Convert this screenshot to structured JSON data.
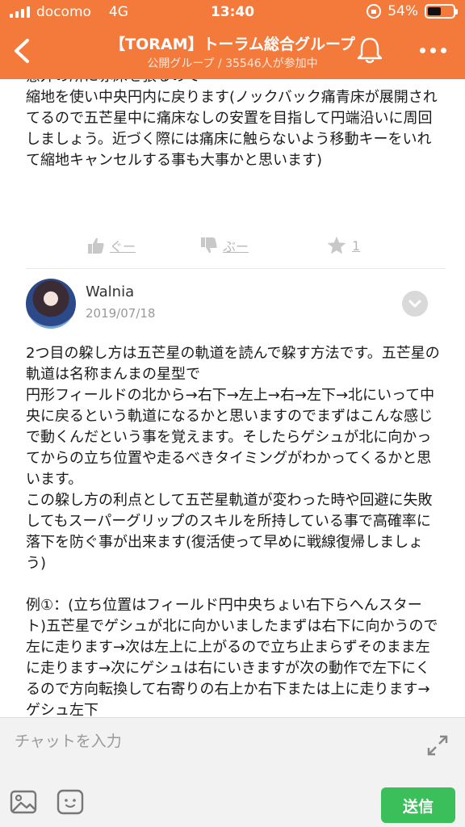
{
  "status_bar": {
    "carrier": "docomo",
    "network": "4G",
    "time": "13:40",
    "battery_percent_text": "54%",
    "battery_level": 0.54
  },
  "header": {
    "title": "【TORAM】トーラム総合グループ",
    "subtitle": "公開グループ / 35546人が参加中",
    "back_icon": "chevron-left-icon",
    "bell_icon": "bell-icon",
    "more_icon": "more-dots-icon",
    "background_color": "#f47a3c"
  },
  "post_top": {
    "text": "意外の所に赤床を張るので\n縮地を使い中央円内に戻ります(ノックバック痛青床が展開されてるので五芒星中に痛床なしの安置を目指して円端沿いに周回しましょう。近づく際には痛床に触らないよう移動キーをいれて縮地キャンセルする事も大事かと思います)",
    "actions": {
      "good_label": "ぐー",
      "bad_label": "ぶー",
      "star_count": "1"
    }
  },
  "comment": {
    "author": "Walnia",
    "date": "2019/07/18",
    "body": "2つ目の躱し方は五芒星の軌道を読んで躱す方法です。五芒星の軌道は名称まんまの星型で\n円形フィールドの北から→右下→左上→右→左下→北にいって中央に戻るという軌道になるかと思いますのでまずはこんな感じで動くんだという事を覚えます。そしたらゲシュが北に向かってからの立ち位置や走るべきタイミングがわかってくるかと思います。\nこの躱し方の利点として五芒星軌道が変わった時や回避に失敗してもスーパーグリップのスキルを所持している事で高確率に落下を防ぐ事が出来ます(復活使って早めに戦線復帰しましょう)\n\n例①：(立ち位置はフィールド円中央ちょい右下らへんスタート)五芒星でゲシュが北に向かいましたまずは右下に向かうので左に走ります→次は左上に上がるので立ち止まらずそのまま左に走ります→次にゲシュは右にいきますが次の動作で左下にくるので方向転換して右寄りの右上か右下または上に走ります→ゲシュ左下"
  },
  "input_bar": {
    "placeholder": "チャットを入力",
    "send_label": "送信",
    "send_color": "#3bbf5a"
  }
}
